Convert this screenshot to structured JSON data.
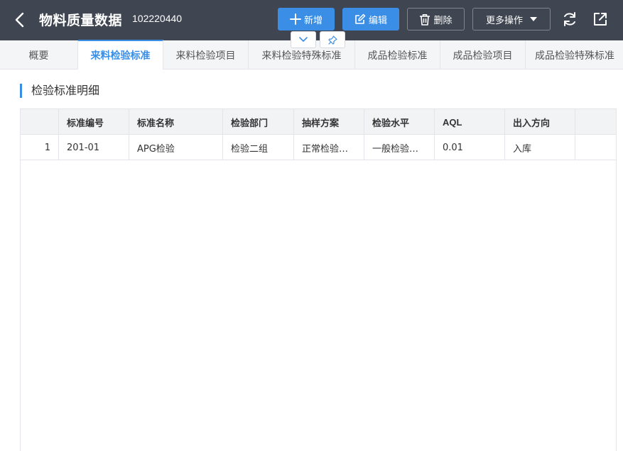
{
  "header": {
    "title": "物料质量数据",
    "code": "102220440",
    "buttons": {
      "add": "新增",
      "edit": "编辑",
      "delete": "删除",
      "more": "更多操作"
    }
  },
  "tabs": [
    {
      "label": "概要"
    },
    {
      "label": "来料检验标准"
    },
    {
      "label": "来料检验项目"
    },
    {
      "label": "来料检验特殊标准"
    },
    {
      "label": "成品检验标准"
    },
    {
      "label": "成品检验项目"
    },
    {
      "label": "成品检验特殊标准"
    }
  ],
  "active_tab": "来料检验标准",
  "section": {
    "title": "检验标准明细"
  },
  "table": {
    "columns": [
      "标准编号",
      "标准名称",
      "检验部门",
      "抽样方案",
      "检验水平",
      "AQL",
      "出入方向"
    ],
    "rows": [
      {
        "index": "1",
        "code": "201-01",
        "name": "APG检验",
        "dept": "检验二组",
        "plan": "正常检验…",
        "level": "一般检验…",
        "aql": "0.01",
        "direction": "入库"
      }
    ]
  },
  "colors": {
    "header_bg": "#3f4652",
    "accent": "#3a8ee6"
  }
}
